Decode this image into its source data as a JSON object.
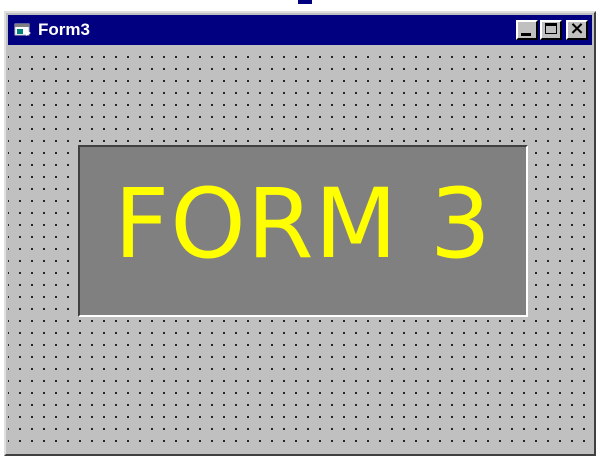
{
  "window": {
    "title": "Form3",
    "controls": {
      "minimize": "minimize",
      "maximize": "maximize",
      "close": "close"
    }
  },
  "label": {
    "text": "FORM 3",
    "text_color": "#ffff00",
    "background_color": "#808080"
  },
  "colors": {
    "titlebar": "#000080",
    "form_background": "#c0c0c0",
    "grid_dots": "#000000"
  },
  "icons": {
    "app": "form-window-icon",
    "minimize": "minimize-icon",
    "maximize": "maximize-icon",
    "close": "close-icon"
  }
}
